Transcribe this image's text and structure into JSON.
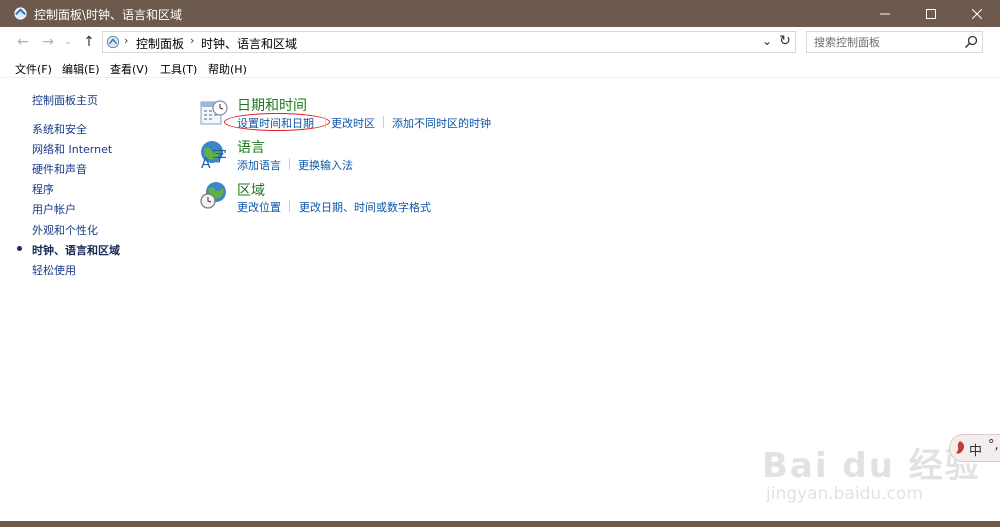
{
  "window": {
    "title": "控制面板\\时钟、语言和区域",
    "colors": {
      "titlebar": "#6e5a4c",
      "link": "#0d56a6",
      "category_title": "#1e7a1e",
      "sidebar_link": "#1a3a8a"
    }
  },
  "address": {
    "crumbs": [
      "控制面板",
      "时钟、语言和区域"
    ],
    "search_placeholder": "搜索控制面板"
  },
  "menu": [
    "文件(F)",
    "编辑(E)",
    "查看(V)",
    "工具(T)",
    "帮助(H)"
  ],
  "sidebar": {
    "items": [
      {
        "label": "控制面板主页"
      },
      {
        "label": "系统和安全"
      },
      {
        "label": "网络和 Internet"
      },
      {
        "label": "硬件和声音"
      },
      {
        "label": "程序"
      },
      {
        "label": "用户帐户"
      },
      {
        "label": "外观和个性化"
      },
      {
        "label": "时钟、语言和区域",
        "active": true
      },
      {
        "label": "轻松使用"
      }
    ]
  },
  "categories": [
    {
      "title": "日期和时间",
      "icon": "calendar-clock-icon",
      "links": [
        "设置时间和日期",
        "更改时区",
        "添加不同时区的时钟"
      ]
    },
    {
      "title": "语言",
      "icon": "language-icon",
      "links": [
        "添加语言",
        "更换输入法"
      ]
    },
    {
      "title": "区域",
      "icon": "region-globe-icon",
      "links": [
        "更改位置",
        "更改日期、时间或数字格式"
      ]
    }
  ],
  "watermark": {
    "text": "Bai du 经验",
    "url": "jingyan.baidu.com"
  },
  "ime": {
    "mode": "中",
    "punct": "°,"
  }
}
